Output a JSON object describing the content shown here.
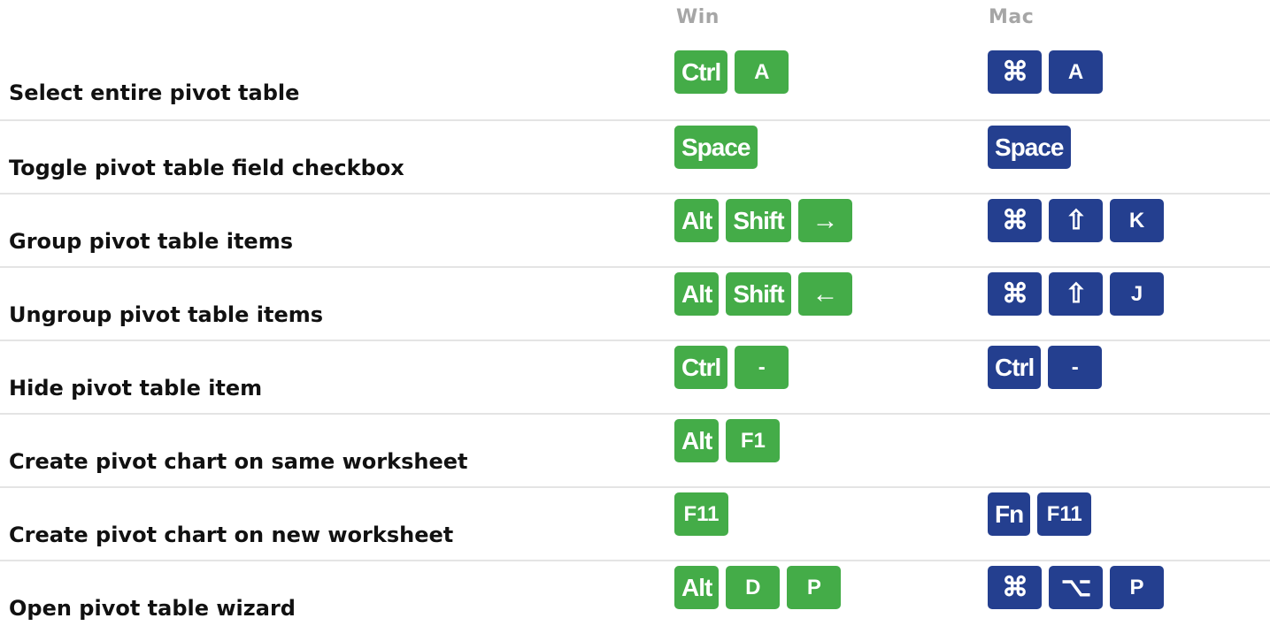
{
  "headers": {
    "win": "Win",
    "mac": "Mac"
  },
  "colors": {
    "win_key": "#44ac48",
    "mac_key": "#243f8f",
    "header": "#a6a6a6",
    "divider": "#e4e4e4"
  },
  "rows": [
    {
      "action": "Select entire pivot table",
      "win": [
        "Ctrl",
        "A"
      ],
      "mac": [
        "⌘",
        "A"
      ]
    },
    {
      "action": "Toggle pivot table field checkbox",
      "win": [
        "Space"
      ],
      "mac": [
        "Space"
      ]
    },
    {
      "action": "Group pivot table items",
      "win": [
        "Alt",
        "Shift",
        "→"
      ],
      "mac": [
        "⌘",
        "⇧",
        "K"
      ]
    },
    {
      "action": "Ungroup pivot table items",
      "win": [
        "Alt",
        "Shift",
        "←"
      ],
      "mac": [
        "⌘",
        "⇧",
        "J"
      ]
    },
    {
      "action": "Hide pivot table item",
      "win": [
        "Ctrl",
        "-"
      ],
      "mac": [
        "Ctrl",
        "-"
      ]
    },
    {
      "action": "Create pivot chart on same worksheet",
      "win": [
        "Alt",
        "F1"
      ],
      "mac": []
    },
    {
      "action": "Create pivot chart on new worksheet",
      "win": [
        "F11"
      ],
      "mac": [
        "Fn",
        "F11"
      ]
    },
    {
      "action": "Open pivot table wizard",
      "win": [
        "Alt",
        "D",
        "P"
      ],
      "mac": [
        "⌘",
        "⌥",
        "P"
      ]
    }
  ]
}
